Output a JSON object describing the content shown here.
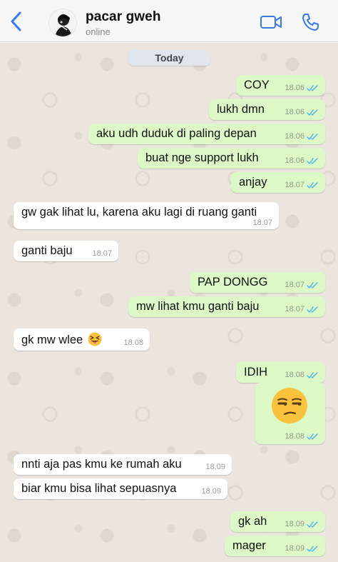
{
  "header": {
    "contact_name": "pacar gweh",
    "status": "online",
    "back_icon": "chevron-left-icon",
    "video_icon": "video-camera-icon",
    "call_icon": "phone-icon",
    "accent_color": "#3478f6"
  },
  "chat": {
    "date_label": "Today",
    "messages": [
      {
        "dir": "out",
        "text": "COY",
        "time": "18.06",
        "status": "read"
      },
      {
        "dir": "out",
        "text": "lukh dmn",
        "time": "18.06",
        "status": "read"
      },
      {
        "dir": "out",
        "text": "aku udh duduk di paling depan",
        "time": "18.06",
        "status": "read"
      },
      {
        "dir": "out",
        "text": "buat nge support lukh",
        "time": "18.06",
        "status": "read"
      },
      {
        "dir": "out",
        "text": "anjay",
        "time": "18.07",
        "status": "read"
      },
      {
        "dir": "in",
        "text": "gw gak lihat lu, karena aku lagi di ruang ganti",
        "time": "18.07"
      },
      {
        "dir": "in",
        "text": "ganti baju",
        "time": "18.07"
      },
      {
        "dir": "out",
        "text": "PAP DONGG",
        "time": "18.07",
        "status": "read"
      },
      {
        "dir": "out",
        "text": "mw lihat kmu ganti baju",
        "time": "18.07",
        "status": "read"
      },
      {
        "dir": "in",
        "text": "gk mw wlee",
        "time": "18.08",
        "emoji": "squinting-face-with-tongue"
      },
      {
        "dir": "out",
        "text": "IDIH",
        "time": "18.08",
        "status": "read"
      },
      {
        "dir": "out",
        "emoji": "unamused-face",
        "time": "18.08",
        "status": "read"
      },
      {
        "dir": "in",
        "text": "nnti aja pas kmu ke rumah aku",
        "time": "18.09"
      },
      {
        "dir": "in",
        "text": "biar kmu bisa lihat sepuasnya",
        "time": "18.09"
      },
      {
        "dir": "out",
        "text": "gk ah",
        "time": "18.09",
        "status": "read"
      },
      {
        "dir": "out",
        "text": "mager",
        "time": "18.09",
        "status": "read"
      }
    ]
  },
  "colors": {
    "outgoing_bubble": "#dcf8c6",
    "incoming_bubble": "#ffffff",
    "chat_background": "#ebe5dd",
    "read_ticks": "#4fb6ec"
  }
}
